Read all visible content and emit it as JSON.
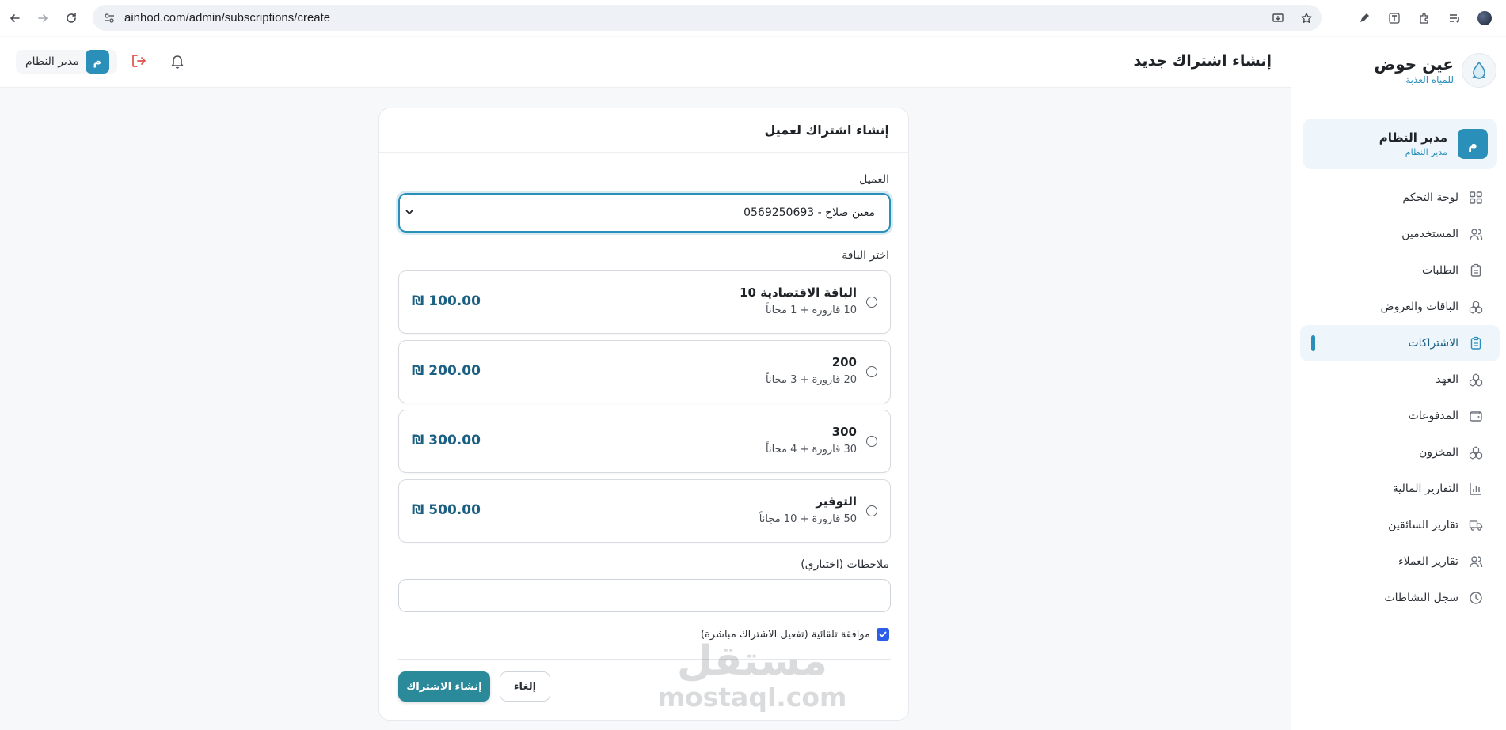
{
  "browser": {
    "url": "ainhod.com/admin/subscriptions/create"
  },
  "header": {
    "title": "إنشاء اشتراك جديد",
    "user_name": "مدير النظام",
    "user_initial": "م"
  },
  "sidebar": {
    "brand_name": "عين حوض",
    "brand_sub": "للمياه العذبة",
    "profile_name": "مدير النظام",
    "profile_role": "مدير النظام",
    "profile_initial": "م",
    "items": [
      {
        "label": "لوحة التحكم",
        "icon": "grid-icon"
      },
      {
        "label": "المستخدمين",
        "icon": "users-icon"
      },
      {
        "label": "الطلبات",
        "icon": "clipboard-icon"
      },
      {
        "label": "الباقات والعروض",
        "icon": "boxes-icon"
      },
      {
        "label": "الاشتراكات",
        "icon": "clipboard-check-icon",
        "active": true
      },
      {
        "label": "العهد",
        "icon": "boxes-icon"
      },
      {
        "label": "المدفوعات",
        "icon": "wallet-icon"
      },
      {
        "label": "المخزون",
        "icon": "boxes-icon"
      },
      {
        "label": "التقارير المالية",
        "icon": "bar-chart-icon"
      },
      {
        "label": "تقارير السائقين",
        "icon": "truck-icon"
      },
      {
        "label": "تقارير العملاء",
        "icon": "users-icon"
      },
      {
        "label": "سجل النشاطات",
        "icon": "clock-icon"
      }
    ]
  },
  "form": {
    "card_title": "إنشاء اشتراك لعميل",
    "customer_label": "العميل",
    "customer_value": "معين صلاح - 0569250693",
    "package_label": "اختر الباقة",
    "packages": [
      {
        "name": "الباقة الاقتصادية 10",
        "desc": "10 قارورة + 1 مجاناً",
        "price": "₪ 100.00"
      },
      {
        "name": "200",
        "desc": "20 قارورة + 3 مجاناً",
        "price": "₪ 200.00"
      },
      {
        "name": "300",
        "desc": "30 قارورة + 4 مجاناً",
        "price": "₪ 300.00"
      },
      {
        "name": "التوفير",
        "desc": "50 قارورة + 10 مجاناً",
        "price": "₪ 500.00"
      }
    ],
    "notes_label": "ملاحظات (اختياري)",
    "notes_value": "",
    "auto_approve_label": "موافقة تلقائية (تفعيل الاشتراك مباشرة)",
    "auto_approve_checked": true,
    "submit_label": "إنشاء الاشتراك",
    "cancel_label": "إلغاء"
  },
  "watermark": {
    "arabic": "مستقل",
    "latin": "mostaql.com"
  },
  "colors": {
    "accent": "#2a8fb9",
    "primary_button": "#2a8a99",
    "price": "#1b5f82",
    "logout": "#e0504a",
    "checkbox": "#2c5ee8"
  }
}
